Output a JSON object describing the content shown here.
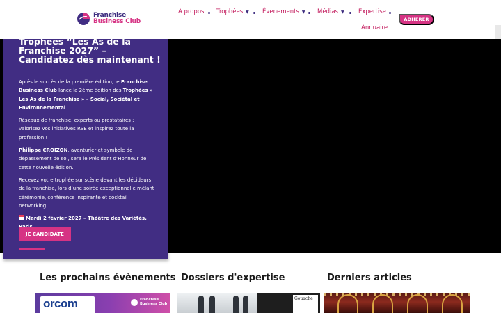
{
  "header": {
    "logo": {
      "line1": "Franchise",
      "line2": "Business Club"
    },
    "nav": [
      {
        "label": "A propos",
        "has_caret": false
      },
      {
        "label": "Trophées",
        "has_caret": true
      },
      {
        "label": "Évenements",
        "has_caret": true
      },
      {
        "label": "Médias",
        "has_caret": true
      },
      {
        "label": "Expertise",
        "has_caret": false
      },
      {
        "label": "Annuaire",
        "has_caret": false
      }
    ],
    "cta_label": "ADHERER"
  },
  "hero_card": {
    "title": "Trophées “Les As de la Franchise 2027” – Candidatez dès maintenant !",
    "p1_a": "Après le succès de la première édition, le ",
    "p1_b": "Franchise Business Club",
    "p1_c": " lance la 2ème édition des ",
    "p1_d": "Trophées « Les As de la Franchise » – Social, Sociétal et Environnemental",
    "p1_e": ".",
    "p2": "Réseaux de franchise, experts ou prestataires : valorisez vos initiatives RSE et inspirez toute la profession !",
    "p3_a": "Philippe CROIZON",
    "p3_b": ", aventurier et symbole de dépassement de soi, sera le Président d’Honneur de cette nouvelle édition.",
    "p4": "Recevez votre trophée sur scène devant les décideurs de la franchise, lors d’une soirée exceptionnelle mêlant cérémonie, conférence inspirante et cocktail networking.",
    "p5": "Mardi 2 février 2027 – Théâtre des Variétés, Paris",
    "button_label": "JE CANDIDATE"
  },
  "sections": {
    "events_title": "Les prochains évènements",
    "expertise_title": "Dossiers d'expertise",
    "articles_title": "Derniers articles"
  },
  "thumbs": {
    "orcom_label": "orcom",
    "fbc_line1": "Franchise",
    "fbc_line2": "Business Club",
    "book_label": "Gouache"
  },
  "colors": {
    "brand_purple": "#412d83",
    "brand_pink": "#d63384",
    "hero_black": "#000000"
  }
}
